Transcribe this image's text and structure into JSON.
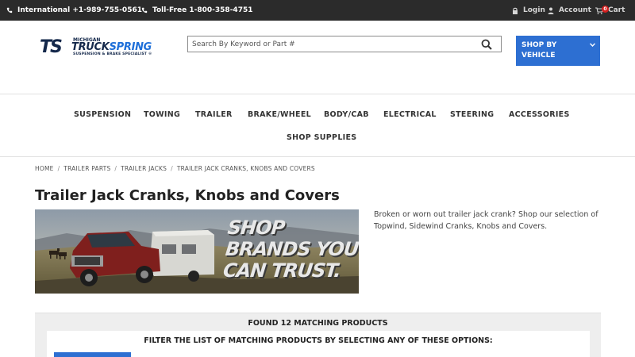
{
  "topbar": {
    "international": "International +1-989-755-0561",
    "tollfree": "Toll-Free 1-800-358-4751",
    "login": "Login",
    "account": "Account",
    "cart_label": "Cart",
    "cart_count": "0"
  },
  "logo": {
    "mark": "TS",
    "line1": "MICHIGAN",
    "line2a": "TRUCK",
    "line2b": "SPRING",
    "line3": "SUSPENSION & BRAKE SPECIALIST ®"
  },
  "search": {
    "placeholder": "Search By Keyword or Part #"
  },
  "shop_vehicle": {
    "line1": "SHOP BY",
    "line2": "VEHICLE"
  },
  "nav": {
    "items": [
      "SUSPENSION",
      "TOWING",
      "TRAILER",
      "BRAKE/WHEEL",
      "BODY/CAB",
      "ELECTRICAL",
      "STEERING",
      "ACCESSORIES",
      "SHOP SUPPLIES"
    ]
  },
  "breadcrumb": [
    "HOME",
    "TRAILER PARTS",
    "TRAILER JACKS",
    "TRAILER JACK CRANKS, KNOBS AND COVERS"
  ],
  "page": {
    "title": "Trailer Jack Cranks, Knobs and Covers",
    "description": "Broken or worn out trailer jack crank? Shop our selection of Topwind, Sidewind Cranks, Knobs and Covers."
  },
  "banner": {
    "line1": "SHOP",
    "line2": "BRANDS YOU",
    "line3": "CAN TRUST."
  },
  "results": {
    "found": "FOUND 12 MATCHING PRODUCTS",
    "filter_title": "FILTER THE LIST OF MATCHING PRODUCTS BY SELECTING ANY OF THESE OPTIONS:"
  },
  "colors": {
    "topbar": "#2b2b2b",
    "accent_blue": "#2d6fd2",
    "logo_navy": "#14284b",
    "cart_badge": "#d31f1f"
  }
}
